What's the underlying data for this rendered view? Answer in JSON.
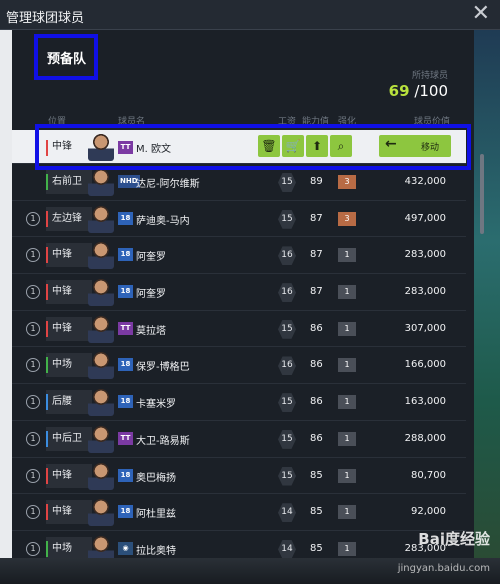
{
  "window": {
    "title": "管理球团球员",
    "close_icon": "close-icon"
  },
  "panel": {
    "section_title": "预备队",
    "owned_label": "所持球员",
    "owned_current": "69",
    "owned_total": "/100"
  },
  "columns": {
    "position": "位置",
    "name": "球员名",
    "work": "工资",
    "ability": "能力值",
    "strength": "强化",
    "price": "球员价值"
  },
  "selected_actions": {
    "trash_icon": "trash-icon",
    "cart_icon": "cart-icon",
    "upgrade_icon": "up-arrow-icon",
    "search_icon": "search-icon",
    "move_label": "移动",
    "move_icon": "arrow-left-icon"
  },
  "players": [
    {
      "num": "",
      "pos": "中锋",
      "tag": "TT",
      "name": "M. 欧文",
      "work": "",
      "ability": "",
      "strength": "",
      "price": ""
    },
    {
      "num": "",
      "pos": "右前卫",
      "tag": "NHD",
      "name": "达尼-阿尔维斯",
      "work": "15",
      "ability": "89",
      "strength": "3",
      "price": "432,000"
    },
    {
      "num": "1",
      "pos": "左边锋",
      "tag": "18",
      "name": "萨迪奥-马内",
      "work": "15",
      "ability": "87",
      "strength": "3",
      "price": "497,000"
    },
    {
      "num": "1",
      "pos": "中锋",
      "tag": "18",
      "name": "阿奎罗",
      "work": "16",
      "ability": "87",
      "strength": "1",
      "price": "283,000"
    },
    {
      "num": "1",
      "pos": "中锋",
      "tag": "18",
      "name": "阿奎罗",
      "work": "16",
      "ability": "87",
      "strength": "1",
      "price": "283,000"
    },
    {
      "num": "1",
      "pos": "中锋",
      "tag": "TT",
      "name": "莫拉塔",
      "work": "15",
      "ability": "86",
      "strength": "1",
      "price": "307,000"
    },
    {
      "num": "1",
      "pos": "中场",
      "tag": "18",
      "name": "保罗-博格巴",
      "work": "16",
      "ability": "86",
      "strength": "1",
      "price": "166,000"
    },
    {
      "num": "1",
      "pos": "后腰",
      "tag": "18",
      "name": "卡塞米罗",
      "work": "15",
      "ability": "86",
      "strength": "1",
      "price": "163,000"
    },
    {
      "num": "1",
      "pos": "中后卫",
      "tag": "TT",
      "name": "大卫-路易斯",
      "work": "15",
      "ability": "86",
      "strength": "1",
      "price": "288,000"
    },
    {
      "num": "1",
      "pos": "中锋",
      "tag": "18",
      "name": "奥巴梅扬",
      "work": "15",
      "ability": "85",
      "strength": "1",
      "price": "80,700"
    },
    {
      "num": "1",
      "pos": "中锋",
      "tag": "18",
      "name": "阿杜里兹",
      "work": "14",
      "ability": "85",
      "strength": "1",
      "price": "92,000"
    },
    {
      "num": "1",
      "pos": "中场",
      "tag": "",
      "name": "拉比奥特",
      "work": "14",
      "ability": "85",
      "strength": "1",
      "price": "283,000"
    }
  ],
  "watermark": {
    "text": "Bai度经验",
    "url_text": "jingyan.baidu.com"
  },
  "colors": {
    "accent_green": "#8dc63f",
    "owned_highlight": "#b9e23d",
    "annotation_blue": "#1010e6"
  }
}
